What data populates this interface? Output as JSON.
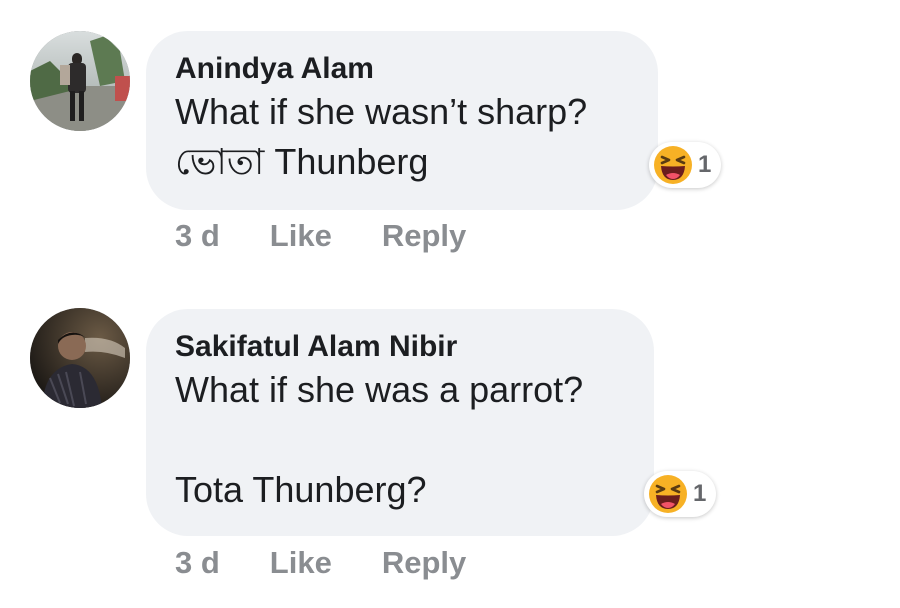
{
  "comments": [
    {
      "author": "Anindya Alam",
      "lines": [
        "What if she wasn’t sharp?",
        "ভোতা Thunberg"
      ],
      "reaction": {
        "icon": "laughing-emoji-icon",
        "count": "1"
      },
      "time": "3 d",
      "like_label": "Like",
      "reply_label": "Reply"
    },
    {
      "author": "Sakifatul Alam Nibir",
      "lines": [
        "What if she was a parrot?",
        "",
        "Tota Thunberg?"
      ],
      "reaction": {
        "icon": "laughing-emoji-icon",
        "count": "1"
      },
      "time": "3 d",
      "like_label": "Like",
      "reply_label": "Reply"
    }
  ],
  "colors": {
    "bubble": "#f0f2f5",
    "text": "#1c1e21",
    "meta": "#8a8d91",
    "emoji_yellow": "#f7b125",
    "emoji_mouth": "#6b1d1d"
  }
}
